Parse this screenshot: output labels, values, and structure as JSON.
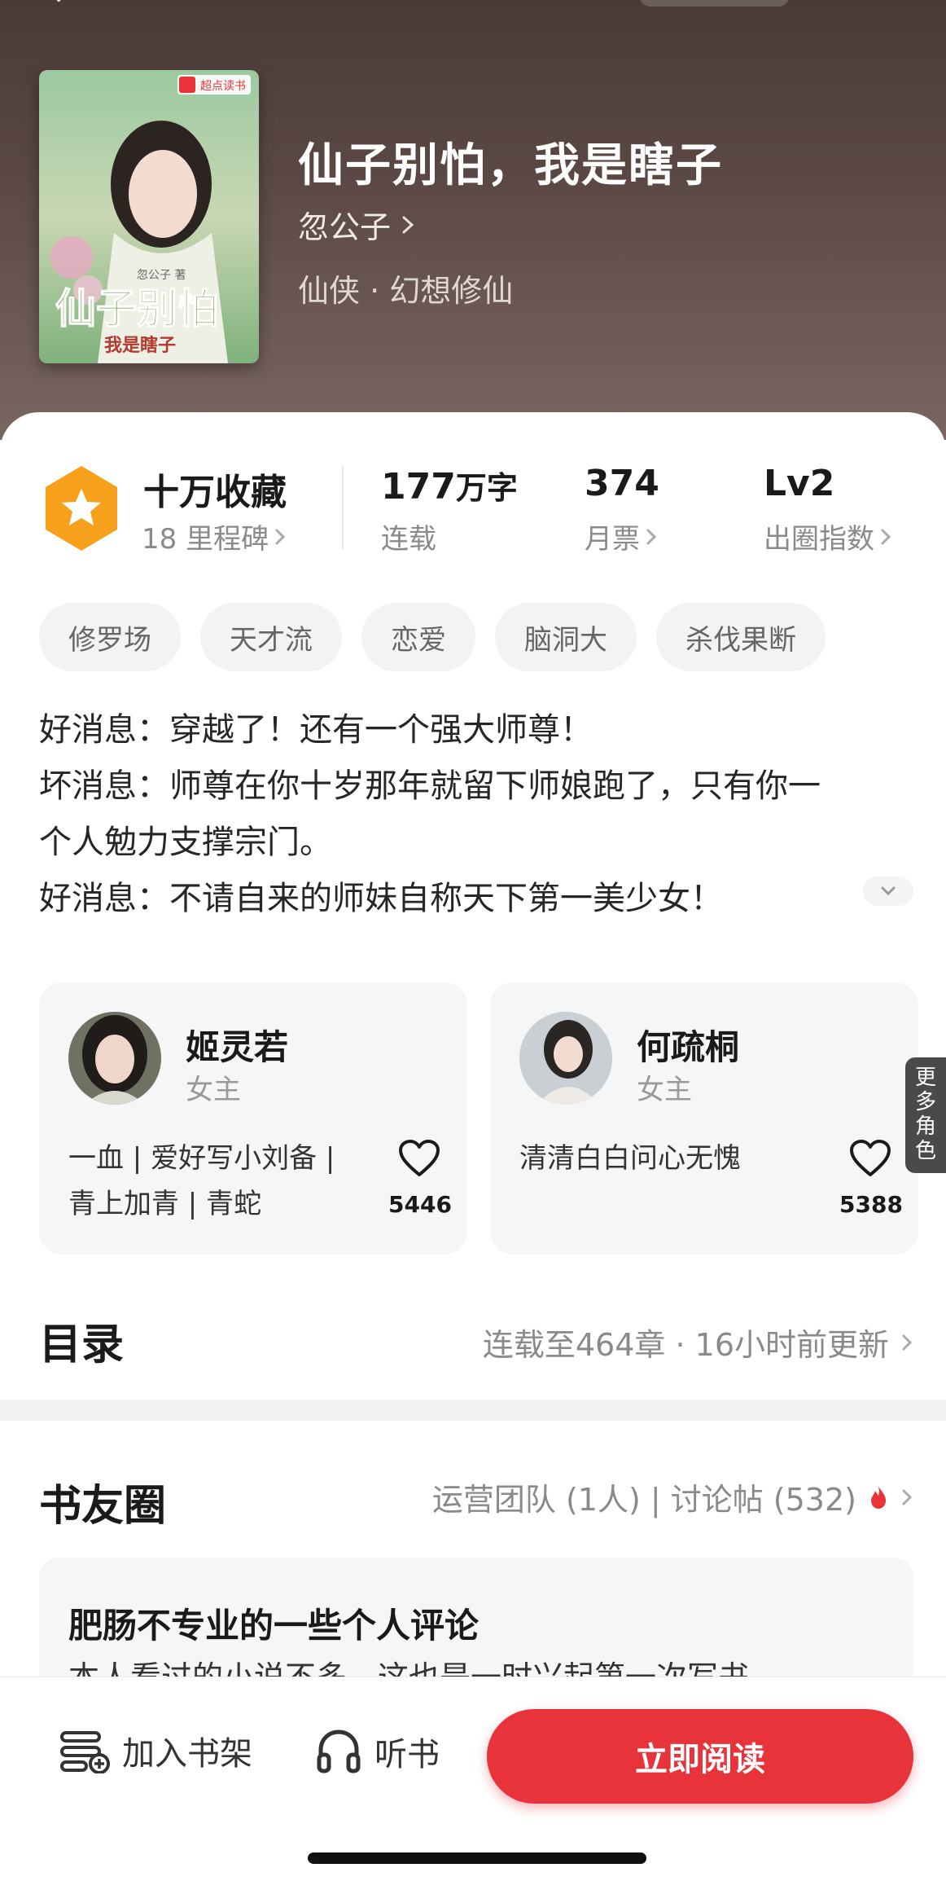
{
  "book": {
    "title": "仙子别怕，我是瞎子",
    "author": "忽公子",
    "genre": "仙侠 · 幻想修仙",
    "cover": {
      "publisher_badge": "超点读书",
      "cover_title": "仙子别怕",
      "cover_subtitle": "我是瞎子",
      "cover_author": "忽公子 著"
    }
  },
  "stats": {
    "collect": {
      "value": "十万收藏",
      "sub": "18 里程碑"
    },
    "words": {
      "value": "177",
      "unit": "万字",
      "sub": "连载"
    },
    "tickets": {
      "value": "374",
      "sub": "月票"
    },
    "level": {
      "value": "Lv2",
      "sub": "出圈指数"
    }
  },
  "tags": [
    "修罗场",
    "天才流",
    "恋爱",
    "脑洞大",
    "杀伐果断"
  ],
  "synopsis": [
    "好消息：穿越了！还有一个强大师尊！",
    "坏消息：师尊在你十岁那年就留下师娘跑了，只有你一",
    "个人勉力支撑宗门。",
    "好消息：不请自来的师妹自称天下第一美少女！"
  ],
  "characters": [
    {
      "name": "姬灵若",
      "role": "女主",
      "desc_lines": [
        "一血 | 爱好写小刘备 |",
        "青上加青 | 青蛇"
      ],
      "likes": "5446"
    },
    {
      "name": "何疏桐",
      "role": "女主",
      "desc_lines": [
        "清清白白问心无愧"
      ],
      "likes": "5388"
    }
  ],
  "more_roles": "更多角色",
  "catalog": {
    "title": "目录",
    "info": "连载至464章 · 16小时前更新"
  },
  "circle": {
    "title": "书友圈",
    "info": "运营团队 (1人) | 讨论帖 (532)",
    "review_title": "肥肠不专业的一些个人评论",
    "review_body": "本人看过的小说不多，这也是一时兴起第一次写书"
  },
  "bottom": {
    "shelf": "加入书架",
    "listen": "听书",
    "read": "立即阅读"
  },
  "colors": {
    "accent": "#e8333b",
    "badge": "#f7a01c",
    "header": "#5b4844"
  }
}
